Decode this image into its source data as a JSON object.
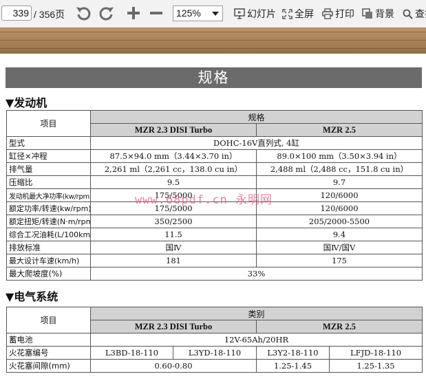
{
  "toolbar": {
    "current_page": "339",
    "page_total": "/ 356页",
    "zoom": "125%",
    "slideshow_label": "幻灯片",
    "fullscreen_label": "全屏",
    "print_label": "打印",
    "background_label": "背景",
    "search_label": "查找"
  },
  "doc": {
    "banner_title": "规格",
    "engine_section": "▼发动机",
    "electrical_section": "▼电气系统",
    "watermark": "www.68pdf.cn 永明网"
  },
  "engine_table": {
    "col_item": "项目",
    "col_spec": "规格",
    "variant_a": "MZR 2.3 DISI Turbo",
    "variant_b": "MZR 2.5",
    "rows": [
      {
        "label": "型式",
        "shared": "DOHC-16V直列式, 4缸"
      },
      {
        "label": "缸径×冲程",
        "a": "87.5×94.0 mm（3.44×3.70 in）",
        "b": "89.0×100 mm（3.50×3.94 in）"
      },
      {
        "label": "排气量",
        "a": "2,261 ml（2,261 cc，138.0 cu in）",
        "b": "2,488 ml（2,488 cc，151.8 cu in）"
      },
      {
        "label": "压缩比",
        "a": "9.5",
        "b": "9.7"
      },
      {
        "label": "发动机最大净功率(kw/rpm)",
        "a": "175/5000",
        "b": "120/6000"
      },
      {
        "label": "额定功率/转速(kw/rpm)",
        "a": "175/5000",
        "b": "120/6000"
      },
      {
        "label": "额定扭矩/转速(N·m/rpm)",
        "a": "350/2500",
        "b": "205/2000-5500"
      },
      {
        "label": "综合工况油耗(L/100km)",
        "a": "11.5",
        "b": "9.4"
      },
      {
        "label": "排放标准",
        "a": "国Ⅳ",
        "b": "国Ⅳ/国Ⅴ"
      },
      {
        "label": "最大设计车速(km/h)",
        "a": "181",
        "b": "175"
      },
      {
        "label": "最大爬坡度(%)",
        "shared": "33%"
      }
    ]
  },
  "electrical_table": {
    "col_item": "项目",
    "col_type": "类别",
    "variant_a": "MZR 2.3 DISI Turbo",
    "variant_b": "MZR 2.5",
    "battery_label": "蓄电池",
    "battery_value": "12V-65Ah/20HR",
    "plug_label": "火花塞编号",
    "plug_values": [
      "L3BD-18-110",
      "L3YD-18-110",
      "L3Y2-18-110",
      "LFJD-18-110"
    ],
    "gap_label": "火花塞间隙(mm)",
    "gap_a": "0.60-0.80",
    "gap_b1": "1.25-1.45",
    "gap_b2": "1.25-1.35"
  },
  "colors": {
    "banner": "#6b6b6b",
    "header": "#d2d2d2",
    "strip": "#a9835a"
  }
}
